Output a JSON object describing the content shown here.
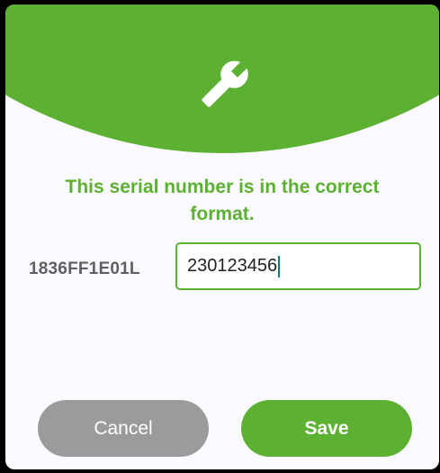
{
  "dialog": {
    "header_icon": "wrench-icon",
    "message": "This serial number is in the correct format.",
    "serial_label": "1836FF1E01L",
    "input_value": "230123456",
    "cancel_label": "Cancel",
    "save_label": "Save"
  },
  "colors": {
    "accent": "#5db132",
    "cancel": "#9b9b9b",
    "label": "#5f5f63",
    "caret": "#0f7c7c"
  }
}
